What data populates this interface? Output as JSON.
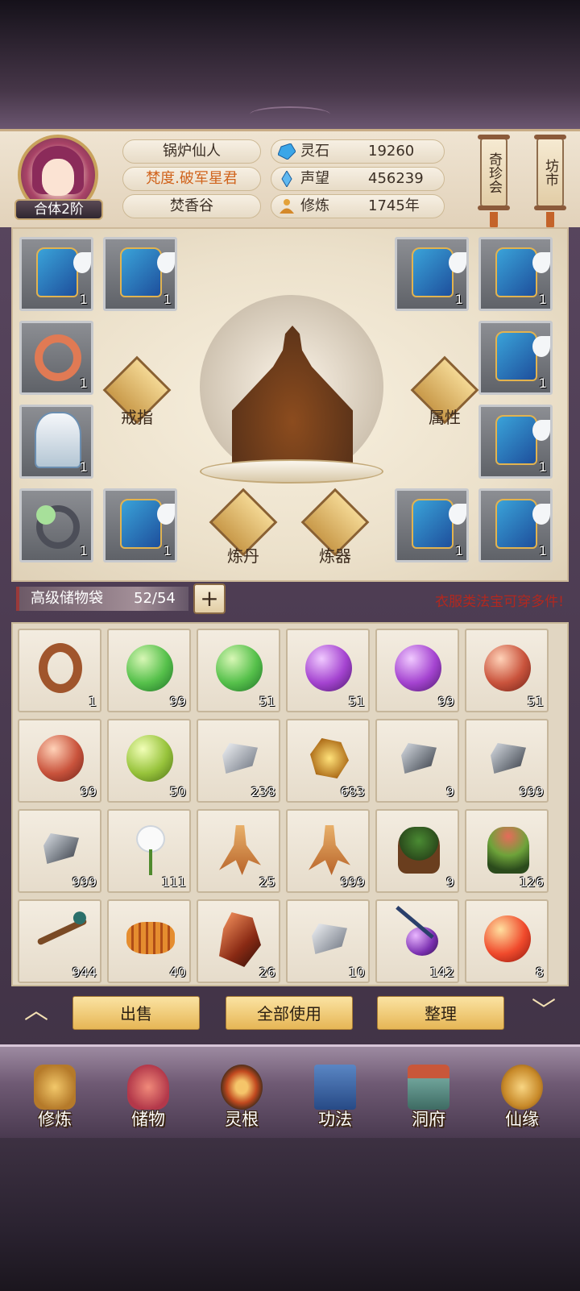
{
  "player": {
    "rank": "合体2阶",
    "name": "锅炉仙人",
    "title": "梵度.破军星君",
    "sect": "焚香谷"
  },
  "resources": [
    {
      "icon": "spirit-stone-icon",
      "label": "灵石",
      "value": "19260"
    },
    {
      "icon": "reputation-icon",
      "label": "声望",
      "value": "456239"
    },
    {
      "icon": "cultivation-icon",
      "label": "修炼",
      "value": "1745年"
    }
  ],
  "shops": {
    "treasure": "奇珍会",
    "market": "坊市"
  },
  "equipment": {
    "left": [
      {
        "item": "armor-icon",
        "count": "1"
      },
      {
        "item": "armor-icon",
        "count": "1"
      },
      {
        "item": "red-ring-icon",
        "count": "1"
      },
      {
        "item": "white-robe-icon",
        "count": "1"
      },
      {
        "item": "jade-ring-icon",
        "count": "1"
      },
      {
        "item": "armor-icon",
        "count": "1"
      }
    ],
    "right": [
      {
        "item": "armor-icon",
        "count": "1"
      },
      {
        "item": "armor-icon",
        "count": "1"
      },
      {
        "item": "armor-icon",
        "count": "1"
      },
      {
        "item": "armor-icon",
        "count": "1"
      },
      {
        "item": "armor-icon",
        "count": "1"
      },
      {
        "item": "armor-icon",
        "count": "1"
      }
    ],
    "buttons": {
      "ring": "戒指",
      "attributes": "属性",
      "alchemy": "炼丹",
      "forging": "炼器"
    }
  },
  "bag": {
    "title": "高级储物袋",
    "count": "52/54",
    "notice": "衣服类法宝可穿多件!"
  },
  "inventory": [
    {
      "item": "ring-item-icon",
      "count": "1"
    },
    {
      "item": "green-orb-icon",
      "count": "99"
    },
    {
      "item": "green-orb-icon",
      "count": "51"
    },
    {
      "item": "purple-orb-icon",
      "count": "51"
    },
    {
      "item": "purple-orb-icon",
      "count": "99"
    },
    {
      "item": "red-orb-icon",
      "count": "51"
    },
    {
      "item": "red-orb-icon",
      "count": "99"
    },
    {
      "item": "lime-orb-icon",
      "count": "50"
    },
    {
      "item": "silver-ore-icon",
      "count": "238"
    },
    {
      "item": "gold-ore-icon",
      "count": "683"
    },
    {
      "item": "dark-ore-icon",
      "count": "9"
    },
    {
      "item": "dark-ore-icon",
      "count": "999"
    },
    {
      "item": "dark-ore-icon",
      "count": "999"
    },
    {
      "item": "white-flower-icon",
      "count": "111"
    },
    {
      "item": "ginseng-icon",
      "count": "25"
    },
    {
      "item": "ginseng-icon",
      "count": "999"
    },
    {
      "item": "herb-root-icon",
      "count": "9"
    },
    {
      "item": "red-herb-icon",
      "count": "126"
    },
    {
      "item": "berry-branch-icon",
      "count": "944"
    },
    {
      "item": "caterpillar-fungus-icon",
      "count": "40"
    },
    {
      "item": "red-crystal-icon",
      "count": "26"
    },
    {
      "item": "silver-ore-icon",
      "count": "10"
    },
    {
      "item": "purple-berry-icon",
      "count": "142"
    },
    {
      "item": "bright-red-orb-icon",
      "count": "8"
    }
  ],
  "actions": {
    "sell": "出售",
    "use_all": "全部使用",
    "sort": "整理"
  },
  "nav": [
    {
      "icon": "cultivation-nav-icon",
      "label": "修炼"
    },
    {
      "icon": "storage-bag-icon",
      "label": "储物"
    },
    {
      "icon": "spirit-root-icon",
      "label": "灵根"
    },
    {
      "icon": "technique-book-icon",
      "label": "功法"
    },
    {
      "icon": "cave-dwelling-icon",
      "label": "洞府"
    },
    {
      "icon": "fortune-gourd-icon",
      "label": "仙缘"
    }
  ],
  "colors": {
    "notice": "#b2281f",
    "title_orange": "#d0631c",
    "button_gold": "#e6b655"
  }
}
